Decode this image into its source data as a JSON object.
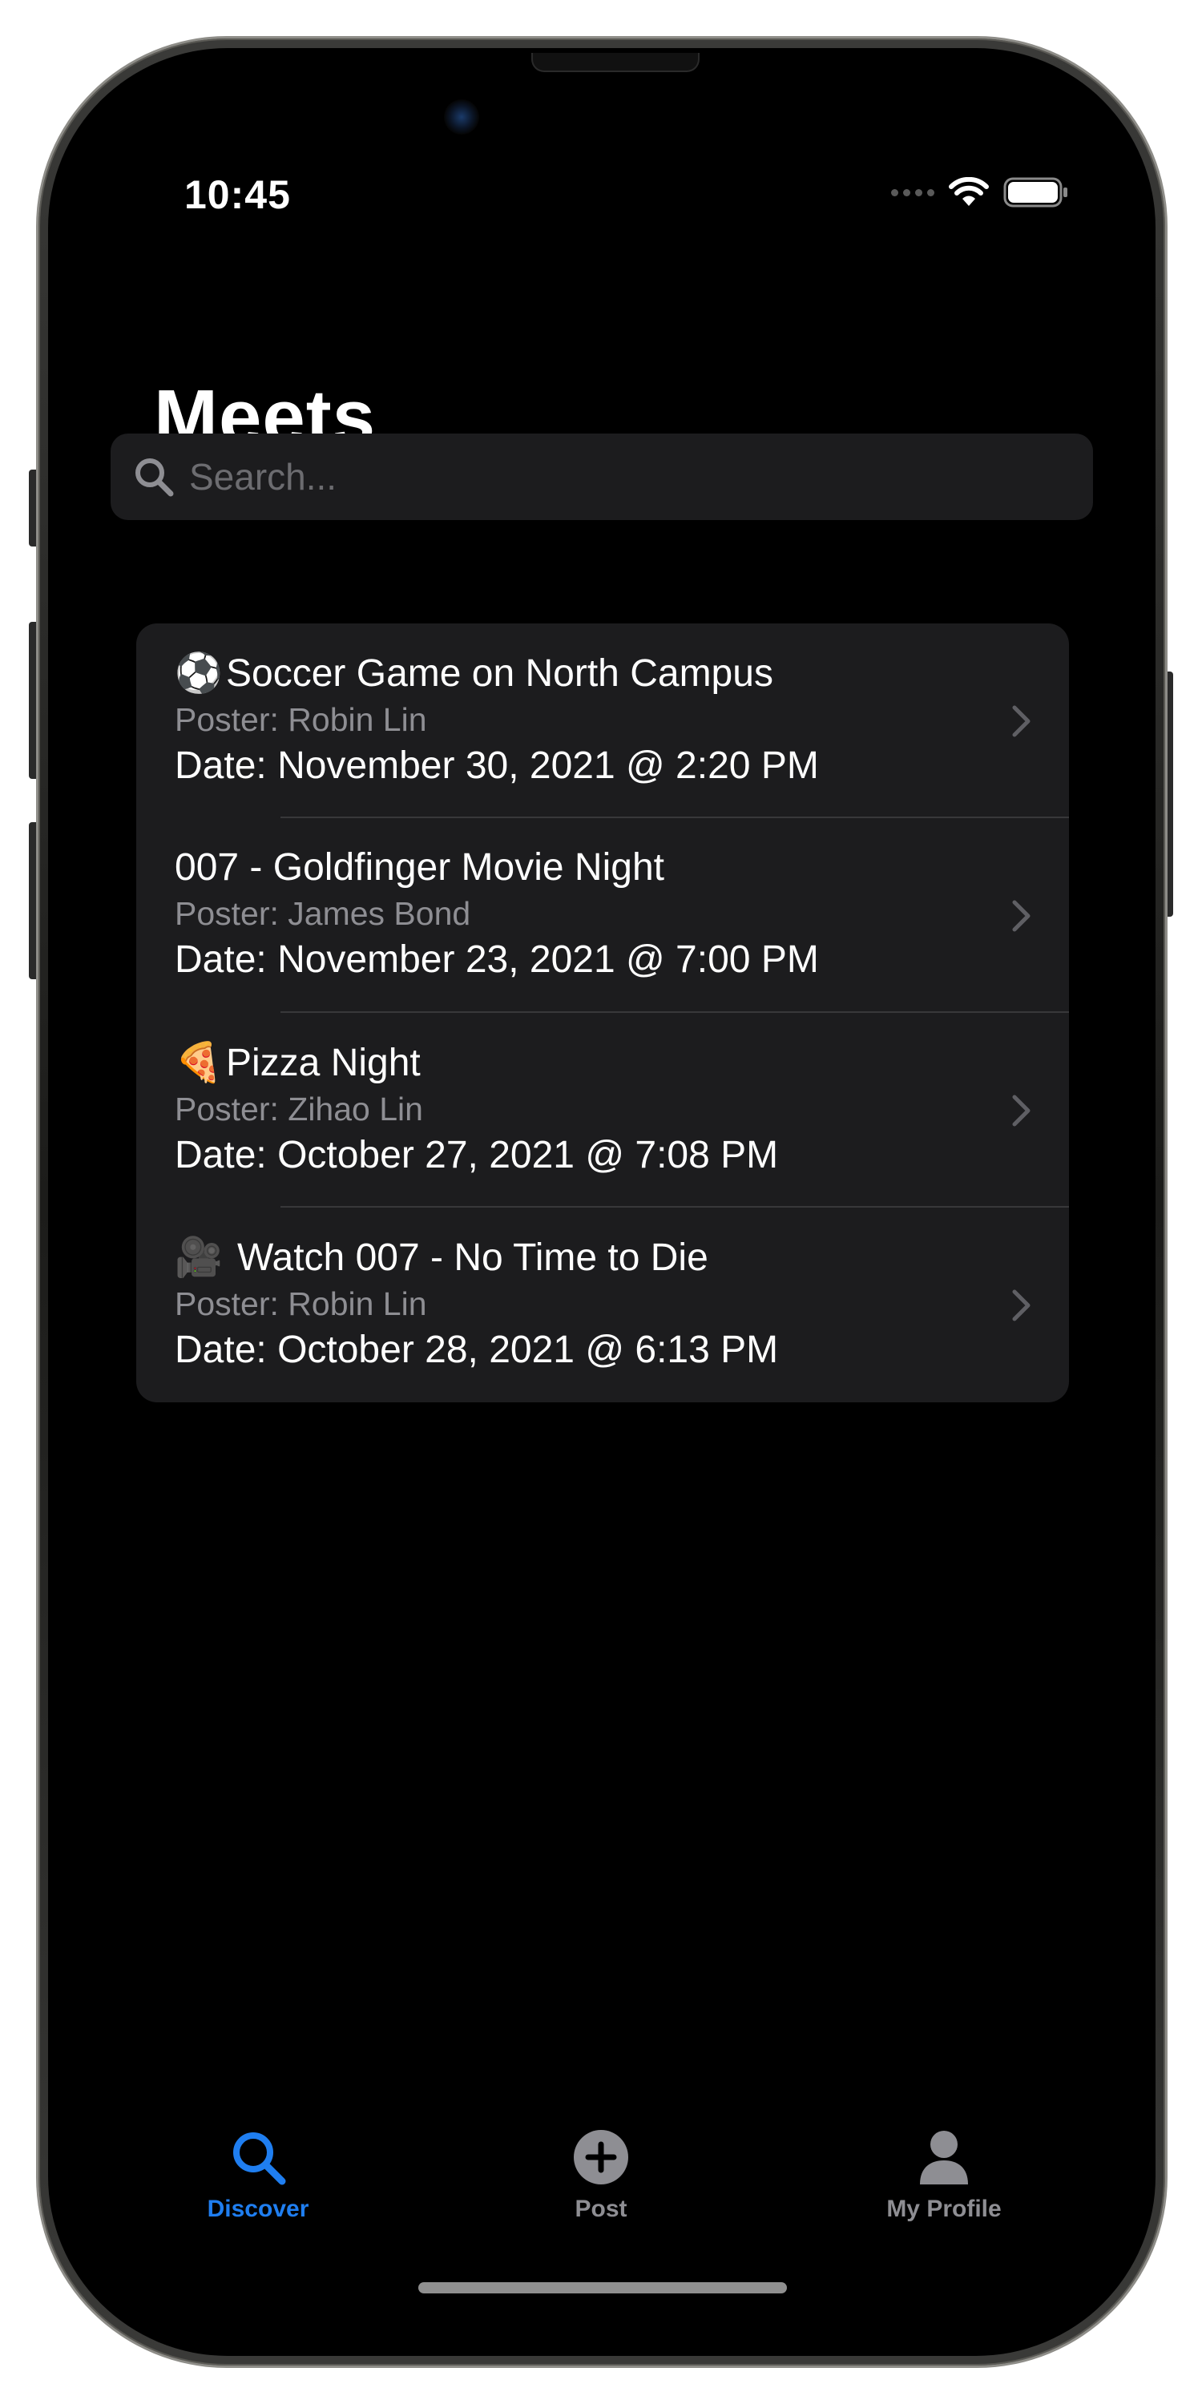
{
  "status_bar": {
    "time": "10:45"
  },
  "header": {
    "title": "Meets"
  },
  "search": {
    "placeholder": "Search..."
  },
  "meets": [
    {
      "emoji": "⚽",
      "icon": "soccer-ball-icon",
      "title": "Soccer Game on North Campus",
      "poster": "Poster: Robin Lin",
      "date": "Date: November 30, 2021 @ 2:20 PM"
    },
    {
      "emoji": "",
      "icon": "",
      "title": "007 - Goldfinger Movie Night",
      "poster": "Poster: James Bond",
      "date": "Date: November 23, 2021 @ 7:00 PM"
    },
    {
      "emoji": "🍕",
      "icon": "pizza-icon",
      "title": "Pizza Night",
      "poster": "Poster: Zihao Lin",
      "date": "Date: October 27, 2021 @ 7:08 PM"
    },
    {
      "emoji": "🎥",
      "icon": "movie-camera-icon",
      "title": "Watch 007 - No Time to Die",
      "poster": "Poster: Robin Lin",
      "date": "Date: October 28, 2021 @ 6:13 PM"
    }
  ],
  "tab_bar": {
    "tabs": [
      {
        "label": "Discover",
        "icon": "magnifying-glass-icon",
        "active": true
      },
      {
        "label": "Post",
        "icon": "plus-circle-icon",
        "active": false
      },
      {
        "label": "My Profile",
        "icon": "person-icon",
        "active": false
      }
    ]
  },
  "colors": {
    "accent": "#1f7ef0",
    "background": "#000000",
    "cell_background": "#1c1c1e",
    "secondary_text": "#8e8e93"
  }
}
